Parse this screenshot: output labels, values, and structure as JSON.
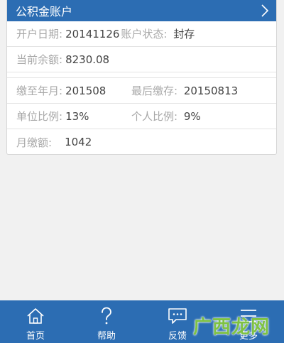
{
  "account": {
    "title": "公积金账户",
    "rows": {
      "open_date_label": "开户日期:",
      "open_date_value": "20141126",
      "status_label": "账户状态:",
      "status_value": "封存",
      "balance_label": "当前余额:",
      "balance_value": "8230.08",
      "paid_to_label": "缴至年月:",
      "paid_to_value": "201508",
      "last_deposit_label": "最后缴存:",
      "last_deposit_value": "20150813",
      "unit_ratio_label": "单位比例:",
      "unit_ratio_value": "13%",
      "personal_ratio_label": "个人比例:",
      "personal_ratio_value": "9%",
      "monthly_label": "月缴额:",
      "monthly_value": "1042"
    }
  },
  "tabbar": {
    "home": "首页",
    "help": "帮助",
    "feedback": "反馈",
    "more": "更多"
  },
  "watermark": "广西龙网",
  "colors": {
    "header_blue": "#2c6db3",
    "label_gray": "#a8a8a8",
    "value_dark": "#444444",
    "watermark_green": "#7ec243"
  }
}
